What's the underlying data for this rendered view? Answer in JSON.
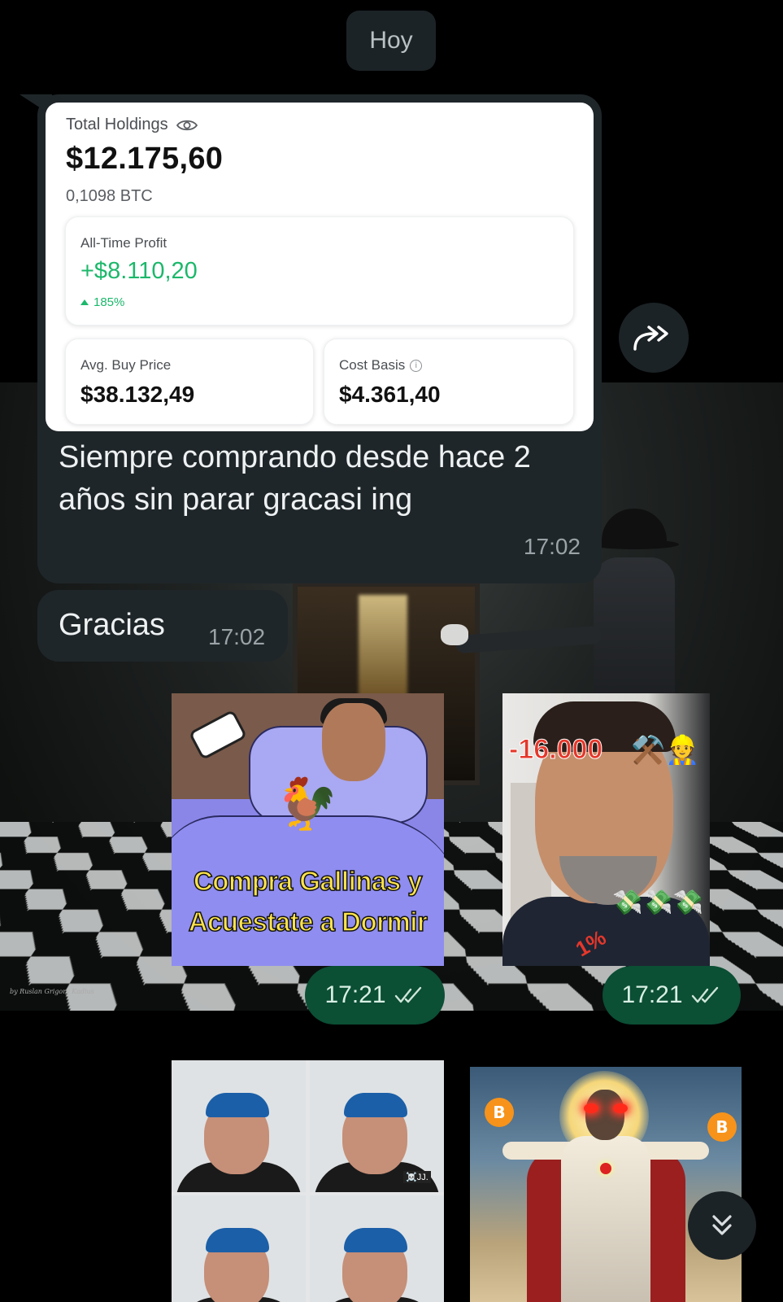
{
  "date_chip": "Hoy",
  "holdings_card": {
    "total_label": "Total Holdings",
    "total_value": "$12.175,60",
    "btc_amount": "0,1098 BTC",
    "profit_label": "All-Time Profit",
    "profit_value": "+$8.110,20",
    "profit_pct": "185%",
    "avg_label": "Avg. Buy Price",
    "avg_value": "$38.132,49",
    "cost_label": "Cost Basis",
    "cost_value": "$4.361,40",
    "info_glyph": "i",
    "colors": {
      "profit_green": "#1cb86b",
      "card_bg": "#ffffff"
    }
  },
  "messages": [
    {
      "text": "Siempre comprando desde hace 2 años sin parar gracasi ing",
      "time": "17:02"
    },
    {
      "text": "Gracias",
      "time": "17:02"
    }
  ],
  "stickers": {
    "gallinas_caption_line1": "Compra Gallinas y",
    "gallinas_caption_line2": "Acuestate a Dormir",
    "miner_number": "-16.000",
    "miner_tools": "⚒️👷",
    "miner_money": "💸💸💸",
    "miner_pct": "1%",
    "rooster_emoji": "🐓",
    "grid_tag": "☠️JJ.",
    "bitcoin_symbol": "B"
  },
  "sent_times": [
    "17:21",
    "17:21"
  ],
  "wallpaper_signature": "by Ruslan Grigory Kadius",
  "icons": {
    "eye": "eye-icon",
    "forward": "forward-icon",
    "double_check": "double-check-icon",
    "scroll_down": "chevrons-down-icon"
  },
  "colors": {
    "incoming_bubble": "#1f2629",
    "sent_pill": "#0b4f35",
    "chip_bg": "#1c2326"
  }
}
